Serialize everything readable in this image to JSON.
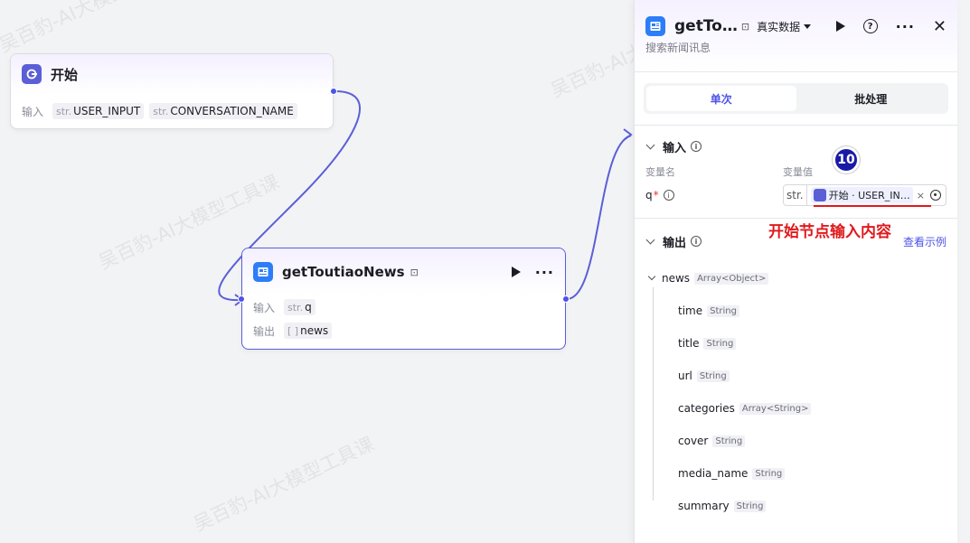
{
  "watermark": "吴百豹-AI大模型工具课",
  "start_node": {
    "title": "开始",
    "input_label": "输入",
    "params": [
      {
        "type": "str.",
        "name": "USER_INPUT"
      },
      {
        "type": "str.",
        "name": "CONVERSATION_NAME"
      }
    ]
  },
  "plugin_node": {
    "title": "getToutiaoNews",
    "input_label": "输入",
    "output_label": "输出",
    "input_param": {
      "type": "str.",
      "name": "q"
    },
    "output_param": {
      "type": "[ ]",
      "name": "news"
    }
  },
  "panel": {
    "title": "getTo…",
    "description": "搜索新闻讯息",
    "mode_select": "真实数据",
    "tabs": [
      "单次",
      "批处理"
    ],
    "input_section": {
      "title": "输入",
      "col_name": "变量名",
      "col_value": "变量值",
      "var_name": "q",
      "required_mark": "*",
      "var_type": "str.",
      "ref_text": "开始 · USER_IN…",
      "clear": "×"
    },
    "output_section": {
      "title": "输出",
      "example_link": "查看示例",
      "root": {
        "name": "news",
        "type": "Array<Object>"
      },
      "fields": [
        {
          "name": "time",
          "type": "String"
        },
        {
          "name": "title",
          "type": "String"
        },
        {
          "name": "url",
          "type": "String"
        },
        {
          "name": "categories",
          "type": "Array<String>"
        },
        {
          "name": "cover",
          "type": "String"
        },
        {
          "name": "media_name",
          "type": "String"
        },
        {
          "name": "summary",
          "type": "String"
        }
      ]
    }
  },
  "annotation": {
    "text": "开始节点输入内容",
    "step": "10",
    "color": "#e0191c"
  }
}
